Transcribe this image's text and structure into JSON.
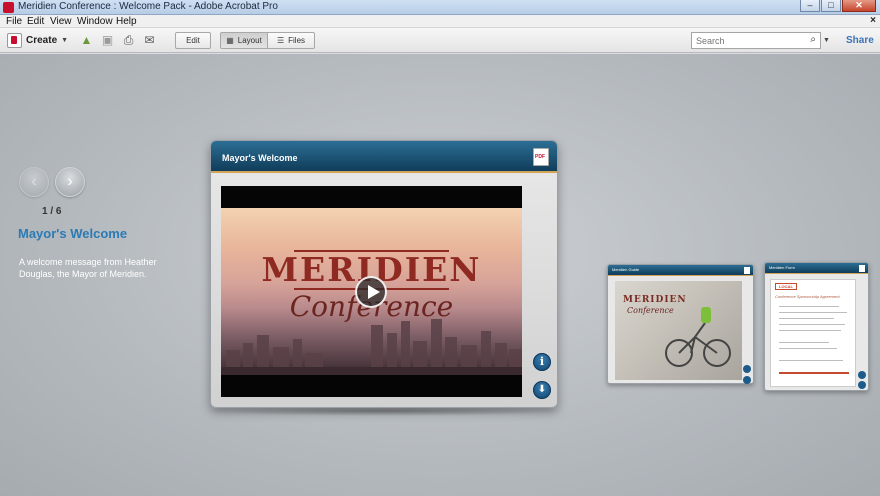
{
  "window": {
    "title": "Meridien Conference : Welcome Pack - Adobe Acrobat Pro"
  },
  "menu": {
    "items": [
      "File",
      "Edit",
      "View",
      "Window",
      "Help"
    ],
    "doc_close": "×"
  },
  "toolbar": {
    "create_label": "Create",
    "edit_label": "Edit",
    "layout_label": "Layout",
    "files_label": "Files",
    "search_placeholder": "Search",
    "share_label": "Share"
  },
  "viewer": {
    "counter": "1 / 6",
    "slide_title": "Mayor's Welcome",
    "slide_description": "A welcome message from Heather Douglas, the Mayor of Meridien."
  },
  "main_card": {
    "header": "Mayor's Welcome",
    "video_title": "MERIDIEN",
    "video_subtitle": "Conference",
    "info_glyph": "i",
    "download_glyph": "⬇"
  },
  "thumbnails": [
    {
      "header": "Meridien Guide",
      "title": "MERIDIEN",
      "subtitle": "Conference"
    },
    {
      "header": "Meridien Form",
      "logo": "LOCAL",
      "heading": "Conference Sponsorship Agreement"
    }
  ],
  "colors": {
    "accent": "#2a7bb5",
    "header_blue": "#103d5a",
    "brand_red": "#8f2a22"
  },
  "icons": [
    "app-icon",
    "create-icon",
    "open-icon",
    "save-icon",
    "print-icon",
    "email-icon",
    "layout-icon",
    "files-icon",
    "binoculars-icon",
    "pdf-icon",
    "play-icon",
    "info-icon",
    "download-icon"
  ]
}
